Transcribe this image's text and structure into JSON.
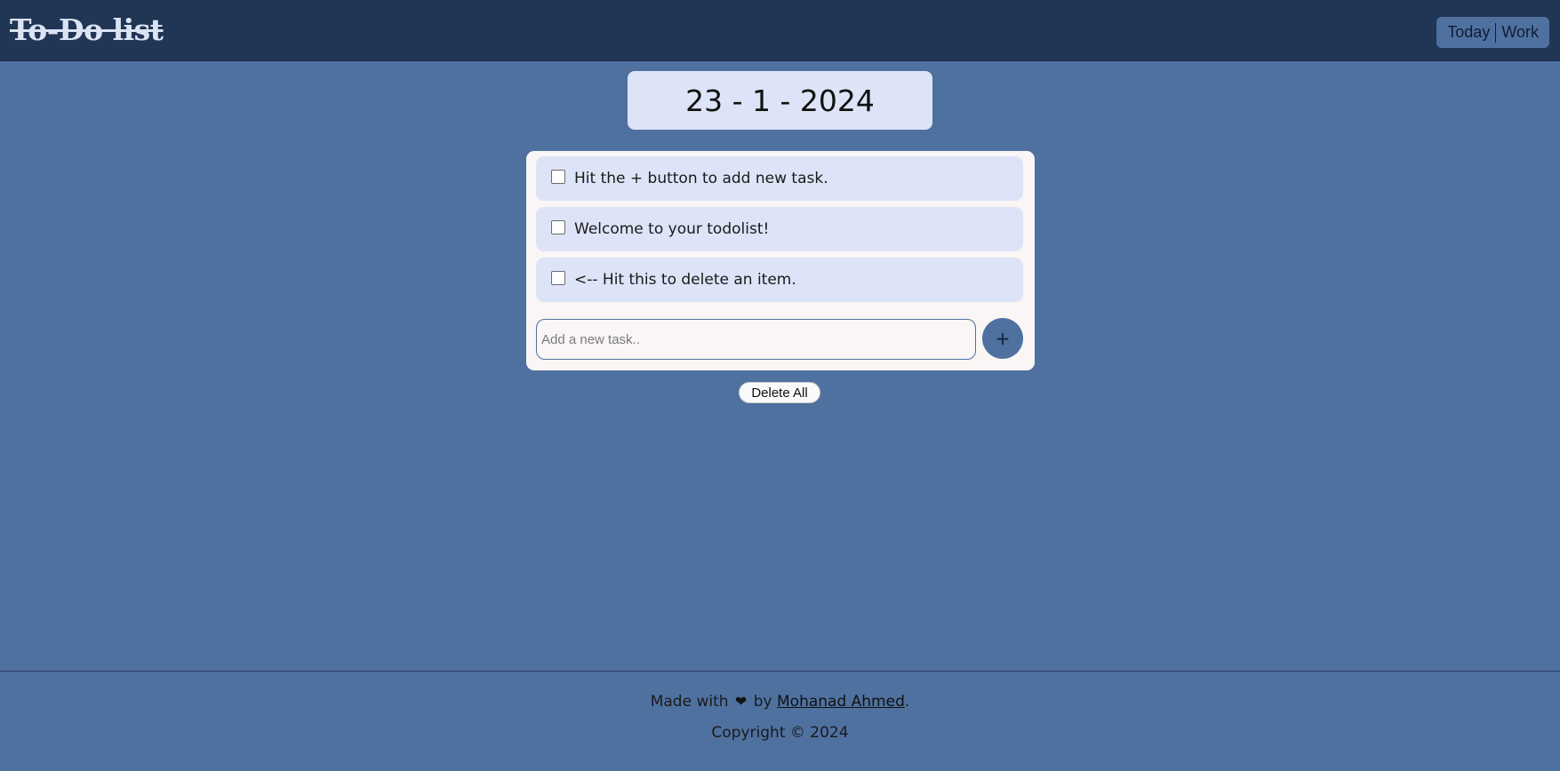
{
  "app": {
    "title": "To-Do list"
  },
  "nav": {
    "items": [
      {
        "label": "Today"
      },
      {
        "label": "Work"
      }
    ]
  },
  "date": {
    "text": "23 - 1 - 2024"
  },
  "tasks": [
    {
      "text": "Hit the + button to add new task.",
      "checked": false
    },
    {
      "text": "Welcome to your todolist!",
      "checked": false
    },
    {
      "text": "<-- Hit this to delete an item.",
      "checked": false
    }
  ],
  "new_task": {
    "value": "",
    "placeholder": "Add a new task..",
    "add_label": "+"
  },
  "delete_all_label": "Delete All",
  "footer": {
    "made_prefix": "Made with",
    "heart_icon": "heart-icon",
    "by": "by",
    "author": "Mohanad Ahmed",
    "suffix": ".",
    "copyright": "Copyright © 2024"
  },
  "colors": {
    "page_bg": "#4f71a0",
    "topbar_bg": "#213555",
    "task_bg": "#dde4f7",
    "card_bg": "#faf6f6",
    "accent": "#4f71a0"
  }
}
